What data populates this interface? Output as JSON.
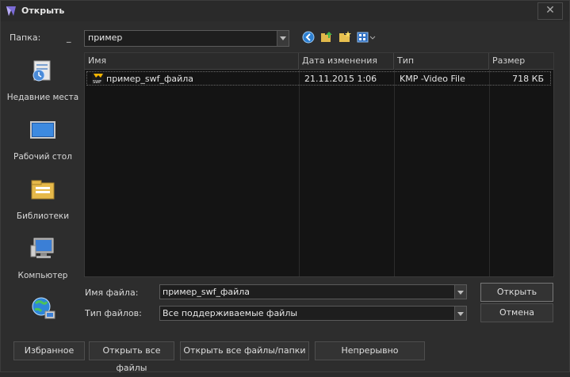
{
  "window": {
    "title": "Открыть",
    "close_glyph": "✕"
  },
  "folder": {
    "label": "Папка:",
    "underscore": "_",
    "value": "пример"
  },
  "toolbar": {
    "icons": [
      "back-icon",
      "up-folder-icon",
      "new-folder-icon",
      "view-menu-icon"
    ]
  },
  "places": [
    {
      "label": "Недавние места",
      "icon": "recent-places-icon"
    },
    {
      "label": "Рабочий стол",
      "icon": "desktop-icon"
    },
    {
      "label": "Библиотеки",
      "icon": "libraries-icon"
    },
    {
      "label": "Компьютер",
      "icon": "computer-icon"
    },
    {
      "label": "",
      "icon": "network-icon"
    }
  ],
  "columns": {
    "name": "Имя",
    "modified": "Дата изменения",
    "type": "Тип",
    "size": "Размер"
  },
  "files": [
    {
      "name": "пример_swf_файла",
      "modified": "21.11.2015 1:06",
      "type": "KMP -Video File",
      "size": "718 КБ",
      "icon": "swf-file-icon"
    }
  ],
  "filename": {
    "label": "Имя файла:",
    "value": "пример_swf_файла"
  },
  "filetype": {
    "label": "Тип файлов:",
    "value": "Все поддерживаемые файлы"
  },
  "buttons": {
    "open": "Открыть",
    "cancel": "Отмена",
    "favorites": "Избранное",
    "open_all_files": "Открыть все файлы",
    "open_all_files_folders": "Открыть все файлы/папки",
    "continuous": "Непрерывно"
  },
  "colors": {
    "background": "#2d2d2d",
    "list_background": "#141414",
    "text": "#d8d8d8"
  }
}
